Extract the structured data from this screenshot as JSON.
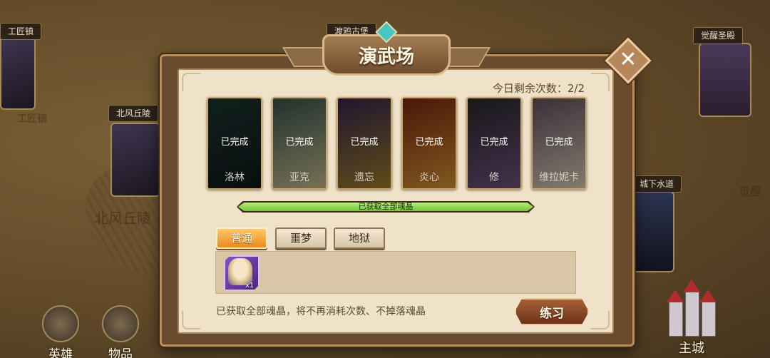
{
  "map": {
    "locations": [
      {
        "name": "工匠镇"
      },
      {
        "name": "北风丘陵"
      },
      {
        "name": "渡鸦古堡"
      },
      {
        "name": "觉醒圣殿"
      },
      {
        "name": "城下水道"
      }
    ],
    "labels": [
      "北风丘陵",
      "工匠镇",
      "觉醒"
    ]
  },
  "bottom_nav": {
    "heroes": "英雄",
    "items": "物品",
    "main_city": "主城"
  },
  "modal": {
    "title": "演武场",
    "remaining_label": "今日剩余次数：2/2",
    "heroes": [
      {
        "name": "洛林",
        "status": "已完成",
        "colors": [
          "#1f3a36",
          "#0f1b1c"
        ]
      },
      {
        "name": "亚克",
        "status": "已完成",
        "colors": [
          "#3d5a55",
          "#d7cf9a"
        ]
      },
      {
        "name": "遗忘",
        "status": "已完成",
        "colors": [
          "#3a2a55",
          "#b08a2e"
        ]
      },
      {
        "name": "炎心",
        "status": "已完成",
        "colors": [
          "#8a2a0e",
          "#e7a23a"
        ]
      },
      {
        "name": "修",
        "status": "已完成",
        "colors": [
          "#2c2c30",
          "#7a5a8a"
        ]
      },
      {
        "name": "维拉妮卡",
        "status": "已完成",
        "colors": [
          "#6a5a6a",
          "#efe0c8"
        ]
      }
    ],
    "progress": {
      "label": "已获取全部魂晶",
      "value": 1.0
    },
    "tabs": [
      {
        "label": "普通",
        "active": true
      },
      {
        "label": "噩梦",
        "active": false
      },
      {
        "label": "地狱",
        "active": false
      }
    ],
    "reward": {
      "quantity": "x1"
    },
    "note": "已获取全部魂晶，将不再消耗次数、不掉落魂晶",
    "practice_button": "练习",
    "close_icon": "close-icon"
  }
}
